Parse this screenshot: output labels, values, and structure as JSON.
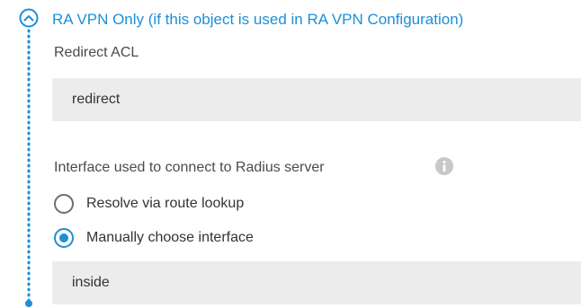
{
  "section": {
    "title": "RA VPN Only (if this object is used in RA VPN Configuration)",
    "accent_color": "#1d8fd6",
    "toggle_icon": "chevron-up-icon"
  },
  "redirect_acl": {
    "label": "Redirect ACL",
    "value": "redirect"
  },
  "interface": {
    "label": "Interface used to connect to Radius server",
    "info_icon": "info-icon",
    "options": [
      {
        "label": "Resolve via route lookup",
        "selected": false
      },
      {
        "label": "Manually choose interface",
        "selected": true
      }
    ],
    "selected_value": "inside"
  }
}
